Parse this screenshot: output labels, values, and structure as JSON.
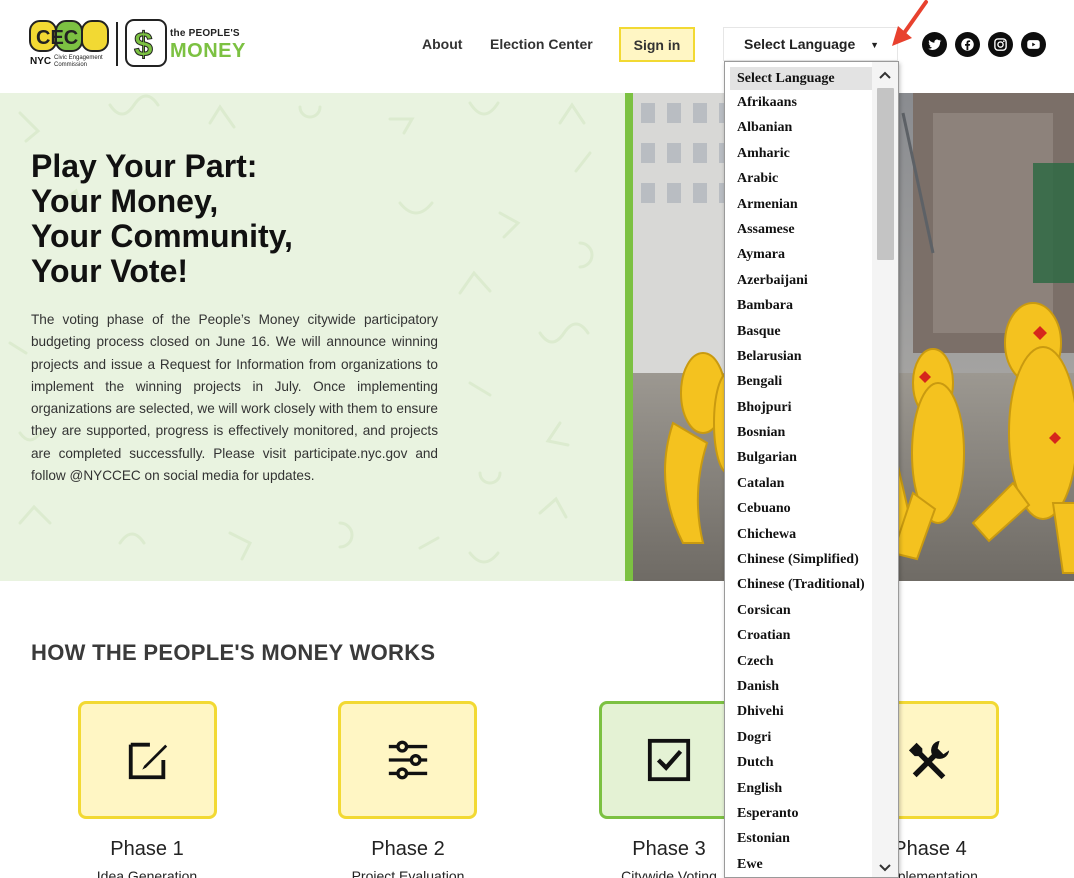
{
  "header": {
    "logo_cec": {
      "mark": "CEC",
      "city": "NYC",
      "line1": "Civic Engagement",
      "line2": "Commission"
    },
    "logo_pm": {
      "small": "the PEOPLE'S",
      "big": "MONEY"
    },
    "nav": {
      "about": "About",
      "election_center": "Election Center"
    },
    "signin_label": "Sign in",
    "language_select_value": "Select Language",
    "social_icons": [
      "twitter-icon",
      "facebook-icon",
      "instagram-icon",
      "youtube-icon"
    ]
  },
  "hero": {
    "title_lines": [
      "Play Your Part:",
      "Your Money,",
      "Your Community,",
      "Your Vote!"
    ],
    "body": "The voting phase of the People’s Money citywide participatory budgeting process closed on June 16. We will announce winning projects and issue a Request for Information from organizations to implement the winning projects in July. Once implementing organizations are selected, we will work closely with them to ensure they are supported, progress is effectively monitored, and projects are completed successfully. Please visit participate.nyc.gov and follow @NYCCEC on social media for updates."
  },
  "how": {
    "title": "HOW THE PEOPLE'S MONEY WORKS",
    "phases": [
      {
        "label": "Phase 1",
        "sub": "Idea Generation",
        "icon": "edit-icon"
      },
      {
        "label": "Phase 2",
        "sub": "Project Evaluation",
        "icon": "sliders-icon"
      },
      {
        "label": "Phase 3",
        "sub": "Citywide Voting",
        "icon": "checkbox-icon"
      },
      {
        "label": "Phase 4",
        "sub": "Implementation",
        "icon": "tools-icon"
      }
    ]
  },
  "language_dropdown": {
    "items": [
      "Select Language",
      "Afrikaans",
      "Albanian",
      "Amharic",
      "Arabic",
      "Armenian",
      "Assamese",
      "Aymara",
      "Azerbaijani",
      "Bambara",
      "Basque",
      "Belarusian",
      "Bengali",
      "Bhojpuri",
      "Bosnian",
      "Bulgarian",
      "Catalan",
      "Cebuano",
      "Chichewa",
      "Chinese (Simplified)",
      "Chinese (Traditional)",
      "Corsican",
      "Croatian",
      "Czech",
      "Danish",
      "Dhivehi",
      "Dogri",
      "Dutch",
      "English",
      "Esperanto",
      "Estonian",
      "Ewe"
    ],
    "selected_index": 0
  },
  "colors": {
    "brand_green": "#7cc142",
    "brand_yellow": "#f2d933",
    "yellow_fill": "#fff6c4",
    "hero_bg": "#e9f3e0",
    "annotation_arrow": "#e8412e"
  }
}
